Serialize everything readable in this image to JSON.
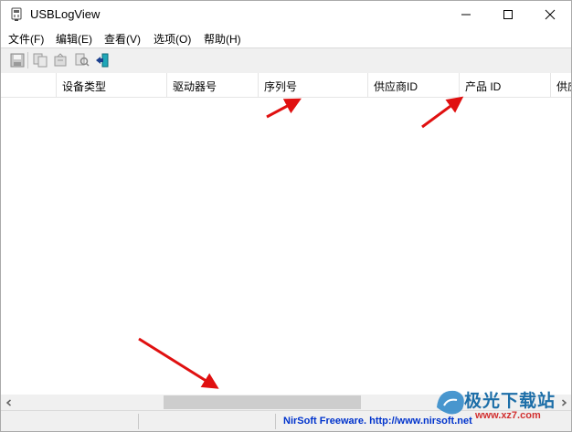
{
  "window": {
    "title": "USBLogView"
  },
  "menu": [
    "文件(F)",
    "编辑(E)",
    "查看(V)",
    "选项(O)",
    "帮助(H)"
  ],
  "toolbar": [
    "save-icon",
    "copy-icon",
    "properties-icon",
    "find-icon",
    "exit-icon"
  ],
  "columns": [
    "",
    "设备类型",
    "驱动器号",
    "序列号",
    "供应商ID",
    "产品 ID",
    "供应"
  ],
  "status": {
    "link": "NirSoft Freeware.  http://www.nirsoft.net"
  },
  "watermark": {
    "text": "极光下载站",
    "url": "www.xz7.com"
  },
  "colors": {
    "arrow": "#e01010",
    "link": "#0033cc",
    "watermark": "#1c6ea8"
  }
}
